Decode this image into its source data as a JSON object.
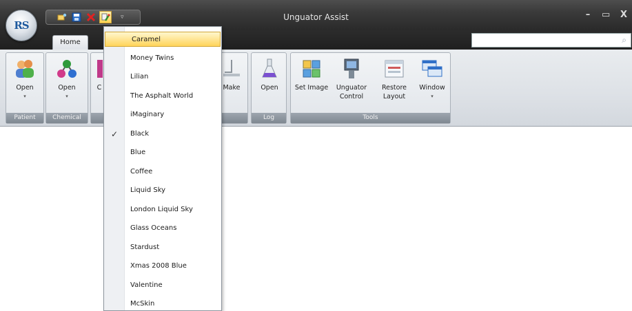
{
  "window": {
    "title": "Unguator Assist",
    "controls": {
      "minimize": "–",
      "maximize": "▭",
      "close": "X"
    }
  },
  "app_menu": {
    "logo": "RS"
  },
  "quick_access": {
    "more_glyph": "▿"
  },
  "tabs": [
    {
      "label": "Home",
      "active": true
    }
  ],
  "search": {
    "value": "",
    "placeholder": ""
  },
  "ribbon": {
    "groups": [
      {
        "label": "Patient",
        "buttons": [
          {
            "label": "Open",
            "dropdown": true
          }
        ]
      },
      {
        "label": "Chemical",
        "buttons": [
          {
            "label": "Open",
            "dropdown": true
          }
        ]
      },
      {
        "label": "",
        "buttons": [
          {
            "label": "C"
          },
          {
            "label": "Make"
          }
        ]
      },
      {
        "label": "Log",
        "buttons": [
          {
            "label": "Open"
          }
        ]
      },
      {
        "label": "Tools",
        "buttons": [
          {
            "label": "Set Image"
          },
          {
            "label": "Unguator Control"
          },
          {
            "label": "Restore Layout"
          },
          {
            "label": "Window",
            "dropdown": true
          }
        ]
      }
    ]
  },
  "skin_menu": {
    "items": [
      {
        "label": "Caramel",
        "highlighted": true,
        "checked": false
      },
      {
        "label": "Money Twins",
        "checked": false
      },
      {
        "label": "Lilian",
        "checked": false
      },
      {
        "label": "The Asphalt World",
        "checked": false
      },
      {
        "label": "iMaginary",
        "checked": false
      },
      {
        "label": "Black",
        "checked": true
      },
      {
        "label": "Blue",
        "checked": false
      },
      {
        "label": "Coffee",
        "checked": false
      },
      {
        "label": "Liquid Sky",
        "checked": false
      },
      {
        "label": "London Liquid Sky",
        "checked": false
      },
      {
        "label": "Glass Oceans",
        "checked": false
      },
      {
        "label": "Stardust",
        "checked": false
      },
      {
        "label": "Xmas 2008 Blue",
        "checked": false
      },
      {
        "label": "Valentine",
        "checked": false
      },
      {
        "label": "McSkin",
        "checked": false
      }
    ],
    "check_glyph": "✓"
  },
  "colors": {
    "titlebar": "#3a3a3a",
    "ribbon": "#dde1e6",
    "menu_highlight": "#ffd45a"
  }
}
